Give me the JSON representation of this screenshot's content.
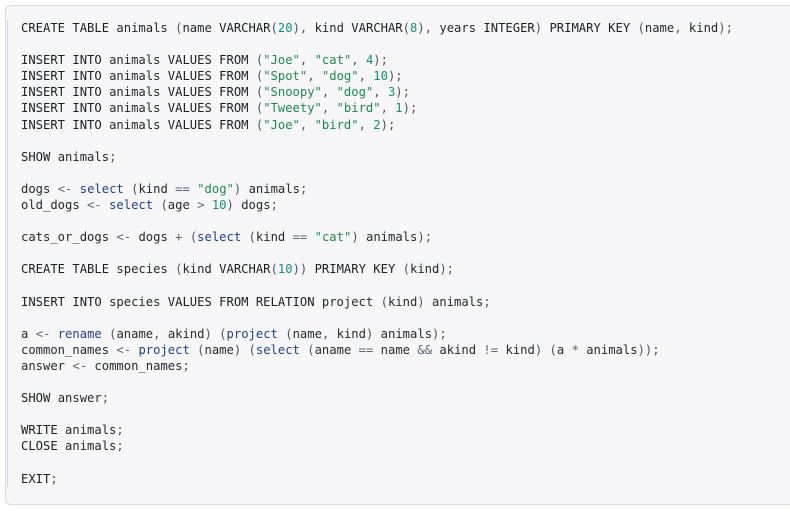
{
  "code_block": {
    "language": "sql-relational-algebra",
    "background": "#f7f7f9",
    "border_color": "#d8d8dd",
    "accent_rule_color": "#cfd8e3",
    "colors": {
      "keyword": "#1b1f23",
      "function": "#1f3f8f",
      "identifier": "#24292e",
      "string": "#1e8a4c",
      "number": "#168f7a",
      "operator": "#5a6570",
      "punctuation": "#4c5560"
    },
    "lines": [
      {
        "n": 1,
        "tokens": [
          {
            "t": "CREATE TABLE ",
            "c": "k"
          },
          {
            "t": "animals",
            "c": "id"
          },
          {
            "t": " (",
            "c": "p"
          },
          {
            "t": "name",
            "c": "id"
          },
          {
            "t": " ",
            "c": "id"
          },
          {
            "t": "VARCHAR",
            "c": "k"
          },
          {
            "t": "(",
            "c": "p"
          },
          {
            "t": "20",
            "c": "num"
          },
          {
            "t": "), ",
            "c": "p"
          },
          {
            "t": "kind",
            "c": "id"
          },
          {
            "t": " ",
            "c": "id"
          },
          {
            "t": "VARCHAR",
            "c": "k"
          },
          {
            "t": "(",
            "c": "p"
          },
          {
            "t": "8",
            "c": "num"
          },
          {
            "t": "), ",
            "c": "p"
          },
          {
            "t": "years",
            "c": "id"
          },
          {
            "t": " ",
            "c": "id"
          },
          {
            "t": "INTEGER",
            "c": "k"
          },
          {
            "t": ") ",
            "c": "p"
          },
          {
            "t": "PRIMARY KEY",
            "c": "k"
          },
          {
            "t": " (",
            "c": "p"
          },
          {
            "t": "name",
            "c": "id"
          },
          {
            "t": ", ",
            "c": "p"
          },
          {
            "t": "kind",
            "c": "id"
          },
          {
            "t": ");",
            "c": "p"
          }
        ]
      },
      {
        "n": 2,
        "tokens": []
      },
      {
        "n": 3,
        "tokens": [
          {
            "t": "INSERT INTO ",
            "c": "k"
          },
          {
            "t": "animals",
            "c": "id"
          },
          {
            "t": " ",
            "c": "id"
          },
          {
            "t": "VALUES FROM",
            "c": "k"
          },
          {
            "t": " (",
            "c": "p"
          },
          {
            "t": "\"Joe\"",
            "c": "str"
          },
          {
            "t": ", ",
            "c": "p"
          },
          {
            "t": "\"cat\"",
            "c": "str"
          },
          {
            "t": ", ",
            "c": "p"
          },
          {
            "t": "4",
            "c": "num"
          },
          {
            "t": ");",
            "c": "p"
          }
        ]
      },
      {
        "n": 4,
        "tokens": [
          {
            "t": "INSERT INTO ",
            "c": "k"
          },
          {
            "t": "animals",
            "c": "id"
          },
          {
            "t": " ",
            "c": "id"
          },
          {
            "t": "VALUES FROM",
            "c": "k"
          },
          {
            "t": " (",
            "c": "p"
          },
          {
            "t": "\"Spot\"",
            "c": "str"
          },
          {
            "t": ", ",
            "c": "p"
          },
          {
            "t": "\"dog\"",
            "c": "str"
          },
          {
            "t": ", ",
            "c": "p"
          },
          {
            "t": "10",
            "c": "num"
          },
          {
            "t": ");",
            "c": "p"
          }
        ]
      },
      {
        "n": 5,
        "tokens": [
          {
            "t": "INSERT INTO ",
            "c": "k"
          },
          {
            "t": "animals",
            "c": "id"
          },
          {
            "t": " ",
            "c": "id"
          },
          {
            "t": "VALUES FROM",
            "c": "k"
          },
          {
            "t": " (",
            "c": "p"
          },
          {
            "t": "\"Snoopy\"",
            "c": "str"
          },
          {
            "t": ", ",
            "c": "p"
          },
          {
            "t": "\"dog\"",
            "c": "str"
          },
          {
            "t": ", ",
            "c": "p"
          },
          {
            "t": "3",
            "c": "num"
          },
          {
            "t": ");",
            "c": "p"
          }
        ]
      },
      {
        "n": 6,
        "tokens": [
          {
            "t": "INSERT INTO ",
            "c": "k"
          },
          {
            "t": "animals",
            "c": "id"
          },
          {
            "t": " ",
            "c": "id"
          },
          {
            "t": "VALUES FROM",
            "c": "k"
          },
          {
            "t": " (",
            "c": "p"
          },
          {
            "t": "\"Tweety\"",
            "c": "str"
          },
          {
            "t": ", ",
            "c": "p"
          },
          {
            "t": "\"bird\"",
            "c": "str"
          },
          {
            "t": ", ",
            "c": "p"
          },
          {
            "t": "1",
            "c": "num"
          },
          {
            "t": ");",
            "c": "p"
          }
        ]
      },
      {
        "n": 7,
        "tokens": [
          {
            "t": "INSERT INTO ",
            "c": "k"
          },
          {
            "t": "animals",
            "c": "id"
          },
          {
            "t": " ",
            "c": "id"
          },
          {
            "t": "VALUES FROM",
            "c": "k"
          },
          {
            "t": " (",
            "c": "p"
          },
          {
            "t": "\"Joe\"",
            "c": "str"
          },
          {
            "t": ", ",
            "c": "p"
          },
          {
            "t": "\"bird\"",
            "c": "str"
          },
          {
            "t": ", ",
            "c": "p"
          },
          {
            "t": "2",
            "c": "num"
          },
          {
            "t": ");",
            "c": "p"
          }
        ]
      },
      {
        "n": 8,
        "tokens": []
      },
      {
        "n": 9,
        "tokens": [
          {
            "t": "SHOW",
            "c": "k"
          },
          {
            "t": " ",
            "c": "id"
          },
          {
            "t": "animals",
            "c": "id"
          },
          {
            "t": ";",
            "c": "p"
          }
        ]
      },
      {
        "n": 10,
        "tokens": []
      },
      {
        "n": 11,
        "tokens": [
          {
            "t": "dogs",
            "c": "id"
          },
          {
            "t": " ",
            "c": "id"
          },
          {
            "t": "<-",
            "c": "op"
          },
          {
            "t": " ",
            "c": "id"
          },
          {
            "t": "select",
            "c": "fn"
          },
          {
            "t": " (",
            "c": "p"
          },
          {
            "t": "kind",
            "c": "id"
          },
          {
            "t": " ",
            "c": "id"
          },
          {
            "t": "==",
            "c": "op"
          },
          {
            "t": " ",
            "c": "id"
          },
          {
            "t": "\"dog\"",
            "c": "str"
          },
          {
            "t": ") ",
            "c": "p"
          },
          {
            "t": "animals",
            "c": "id"
          },
          {
            "t": ";",
            "c": "p"
          }
        ]
      },
      {
        "n": 12,
        "tokens": [
          {
            "t": "old_dogs",
            "c": "id"
          },
          {
            "t": " ",
            "c": "id"
          },
          {
            "t": "<-",
            "c": "op"
          },
          {
            "t": " ",
            "c": "id"
          },
          {
            "t": "select",
            "c": "fn"
          },
          {
            "t": " (",
            "c": "p"
          },
          {
            "t": "age",
            "c": "id"
          },
          {
            "t": " ",
            "c": "id"
          },
          {
            "t": ">",
            "c": "op"
          },
          {
            "t": " ",
            "c": "id"
          },
          {
            "t": "10",
            "c": "num"
          },
          {
            "t": ") ",
            "c": "p"
          },
          {
            "t": "dogs",
            "c": "id"
          },
          {
            "t": ";",
            "c": "p"
          }
        ]
      },
      {
        "n": 13,
        "tokens": []
      },
      {
        "n": 14,
        "tokens": [
          {
            "t": "cats_or_dogs",
            "c": "id"
          },
          {
            "t": " ",
            "c": "id"
          },
          {
            "t": "<-",
            "c": "op"
          },
          {
            "t": " ",
            "c": "id"
          },
          {
            "t": "dogs",
            "c": "id"
          },
          {
            "t": " ",
            "c": "id"
          },
          {
            "t": "+",
            "c": "op"
          },
          {
            "t": " (",
            "c": "p"
          },
          {
            "t": "select",
            "c": "fn"
          },
          {
            "t": " (",
            "c": "p"
          },
          {
            "t": "kind",
            "c": "id"
          },
          {
            "t": " ",
            "c": "id"
          },
          {
            "t": "==",
            "c": "op"
          },
          {
            "t": " ",
            "c": "id"
          },
          {
            "t": "\"cat\"",
            "c": "str"
          },
          {
            "t": ") ",
            "c": "p"
          },
          {
            "t": "animals",
            "c": "id"
          },
          {
            "t": ");",
            "c": "p"
          }
        ]
      },
      {
        "n": 15,
        "tokens": []
      },
      {
        "n": 16,
        "tokens": [
          {
            "t": "CREATE TABLE ",
            "c": "k"
          },
          {
            "t": "species",
            "c": "id"
          },
          {
            "t": " (",
            "c": "p"
          },
          {
            "t": "kind",
            "c": "id"
          },
          {
            "t": " ",
            "c": "id"
          },
          {
            "t": "VARCHAR",
            "c": "k"
          },
          {
            "t": "(",
            "c": "p"
          },
          {
            "t": "10",
            "c": "num"
          },
          {
            "t": ")) ",
            "c": "p"
          },
          {
            "t": "PRIMARY KEY",
            "c": "k"
          },
          {
            "t": " (",
            "c": "p"
          },
          {
            "t": "kind",
            "c": "id"
          },
          {
            "t": ");",
            "c": "p"
          }
        ]
      },
      {
        "n": 17,
        "tokens": []
      },
      {
        "n": 18,
        "tokens": [
          {
            "t": "INSERT INTO ",
            "c": "k"
          },
          {
            "t": "species",
            "c": "id"
          },
          {
            "t": " ",
            "c": "id"
          },
          {
            "t": "VALUES FROM RELATION",
            "c": "k"
          },
          {
            "t": " ",
            "c": "id"
          },
          {
            "t": "project",
            "c": "id"
          },
          {
            "t": " (",
            "c": "p"
          },
          {
            "t": "kind",
            "c": "id"
          },
          {
            "t": ") ",
            "c": "p"
          },
          {
            "t": "animals",
            "c": "id"
          },
          {
            "t": ";",
            "c": "p"
          }
        ]
      },
      {
        "n": 19,
        "tokens": []
      },
      {
        "n": 20,
        "tokens": [
          {
            "t": "a",
            "c": "id"
          },
          {
            "t": " ",
            "c": "id"
          },
          {
            "t": "<-",
            "c": "op"
          },
          {
            "t": " ",
            "c": "id"
          },
          {
            "t": "rename",
            "c": "fn"
          },
          {
            "t": " (",
            "c": "p"
          },
          {
            "t": "aname",
            "c": "id"
          },
          {
            "t": ", ",
            "c": "p"
          },
          {
            "t": "akind",
            "c": "id"
          },
          {
            "t": ") (",
            "c": "p"
          },
          {
            "t": "project",
            "c": "fn"
          },
          {
            "t": " (",
            "c": "p"
          },
          {
            "t": "name",
            "c": "id"
          },
          {
            "t": ", ",
            "c": "p"
          },
          {
            "t": "kind",
            "c": "id"
          },
          {
            "t": ") ",
            "c": "p"
          },
          {
            "t": "animals",
            "c": "id"
          },
          {
            "t": ");",
            "c": "p"
          }
        ]
      },
      {
        "n": 21,
        "tokens": [
          {
            "t": "common_names",
            "c": "id"
          },
          {
            "t": " ",
            "c": "id"
          },
          {
            "t": "<-",
            "c": "op"
          },
          {
            "t": " ",
            "c": "id"
          },
          {
            "t": "project",
            "c": "fn"
          },
          {
            "t": " (",
            "c": "p"
          },
          {
            "t": "name",
            "c": "id"
          },
          {
            "t": ") (",
            "c": "p"
          },
          {
            "t": "select",
            "c": "fn"
          },
          {
            "t": " (",
            "c": "p"
          },
          {
            "t": "aname",
            "c": "id"
          },
          {
            "t": " ",
            "c": "id"
          },
          {
            "t": "==",
            "c": "op"
          },
          {
            "t": " ",
            "c": "id"
          },
          {
            "t": "name",
            "c": "id"
          },
          {
            "t": " ",
            "c": "id"
          },
          {
            "t": "&&",
            "c": "op"
          },
          {
            "t": " ",
            "c": "id"
          },
          {
            "t": "akind",
            "c": "id"
          },
          {
            "t": " ",
            "c": "id"
          },
          {
            "t": "!=",
            "c": "op"
          },
          {
            "t": " ",
            "c": "id"
          },
          {
            "t": "kind",
            "c": "id"
          },
          {
            "t": ") (",
            "c": "p"
          },
          {
            "t": "a",
            "c": "id"
          },
          {
            "t": " ",
            "c": "id"
          },
          {
            "t": "*",
            "c": "op"
          },
          {
            "t": " ",
            "c": "id"
          },
          {
            "t": "animals",
            "c": "id"
          },
          {
            "t": "));",
            "c": "p"
          }
        ]
      },
      {
        "n": 22,
        "tokens": [
          {
            "t": "answer",
            "c": "id"
          },
          {
            "t": " ",
            "c": "id"
          },
          {
            "t": "<-",
            "c": "op"
          },
          {
            "t": " ",
            "c": "id"
          },
          {
            "t": "common_names",
            "c": "id"
          },
          {
            "t": ";",
            "c": "p"
          }
        ]
      },
      {
        "n": 23,
        "tokens": []
      },
      {
        "n": 24,
        "tokens": [
          {
            "t": "SHOW",
            "c": "k"
          },
          {
            "t": " ",
            "c": "id"
          },
          {
            "t": "answer",
            "c": "id"
          },
          {
            "t": ";",
            "c": "p"
          }
        ]
      },
      {
        "n": 25,
        "tokens": []
      },
      {
        "n": 26,
        "tokens": [
          {
            "t": "WRITE",
            "c": "k"
          },
          {
            "t": " ",
            "c": "id"
          },
          {
            "t": "animals",
            "c": "id"
          },
          {
            "t": ";",
            "c": "p"
          }
        ]
      },
      {
        "n": 27,
        "tokens": [
          {
            "t": "CLOSE",
            "c": "k"
          },
          {
            "t": " ",
            "c": "id"
          },
          {
            "t": "animals",
            "c": "id"
          },
          {
            "t": ";",
            "c": "p"
          }
        ]
      },
      {
        "n": 28,
        "tokens": []
      },
      {
        "n": 29,
        "tokens": [
          {
            "t": "EXIT",
            "c": "k"
          },
          {
            "t": ";",
            "c": "p"
          }
        ]
      }
    ],
    "plain_text": "CREATE TABLE animals (name VARCHAR(20), kind VARCHAR(8), years INTEGER) PRIMARY KEY (name, kind);\n\nINSERT INTO animals VALUES FROM (\"Joe\", \"cat\", 4);\nINSERT INTO animals VALUES FROM (\"Spot\", \"dog\", 10);\nINSERT INTO animals VALUES FROM (\"Snoopy\", \"dog\", 3);\nINSERT INTO animals VALUES FROM (\"Tweety\", \"bird\", 1);\nINSERT INTO animals VALUES FROM (\"Joe\", \"bird\", 2);\n\nSHOW animals;\n\ndogs <- select (kind == \"dog\") animals;\nold_dogs <- select (age > 10) dogs;\n\ncats_or_dogs <- dogs + (select (kind == \"cat\") animals);\n\nCREATE TABLE species (kind VARCHAR(10)) PRIMARY KEY (kind);\n\nINSERT INTO species VALUES FROM RELATION project (kind) animals;\n\na <- rename (aname, akind) (project (name, kind) animals);\ncommon_names <- project (name) (select (aname == name && akind != kind) (a * animals));\nanswer <- common_names;\n\nSHOW answer;\n\nWRITE animals;\nCLOSE animals;\n\nEXIT;"
  }
}
